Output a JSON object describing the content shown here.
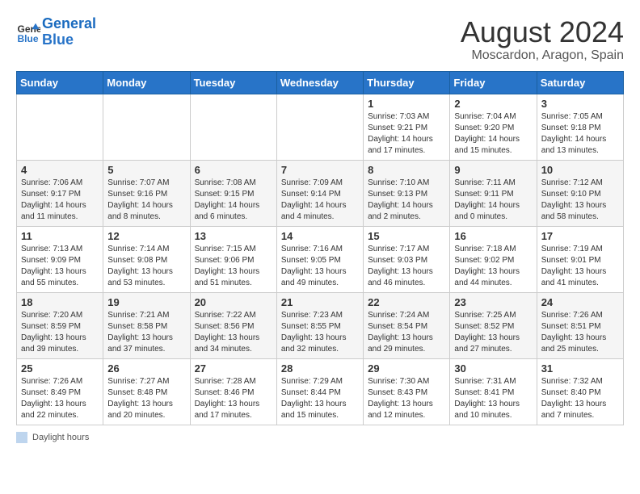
{
  "header": {
    "logo_line1": "General",
    "logo_line2": "Blue",
    "month_year": "August 2024",
    "location": "Moscardon, Aragon, Spain"
  },
  "days_of_week": [
    "Sunday",
    "Monday",
    "Tuesday",
    "Wednesday",
    "Thursday",
    "Friday",
    "Saturday"
  ],
  "weeks": [
    [
      {
        "day": "",
        "info": ""
      },
      {
        "day": "",
        "info": ""
      },
      {
        "day": "",
        "info": ""
      },
      {
        "day": "",
        "info": ""
      },
      {
        "day": "1",
        "info": "Sunrise: 7:03 AM\nSunset: 9:21 PM\nDaylight: 14 hours\nand 17 minutes."
      },
      {
        "day": "2",
        "info": "Sunrise: 7:04 AM\nSunset: 9:20 PM\nDaylight: 14 hours\nand 15 minutes."
      },
      {
        "day": "3",
        "info": "Sunrise: 7:05 AM\nSunset: 9:18 PM\nDaylight: 14 hours\nand 13 minutes."
      }
    ],
    [
      {
        "day": "4",
        "info": "Sunrise: 7:06 AM\nSunset: 9:17 PM\nDaylight: 14 hours\nand 11 minutes."
      },
      {
        "day": "5",
        "info": "Sunrise: 7:07 AM\nSunset: 9:16 PM\nDaylight: 14 hours\nand 8 minutes."
      },
      {
        "day": "6",
        "info": "Sunrise: 7:08 AM\nSunset: 9:15 PM\nDaylight: 14 hours\nand 6 minutes."
      },
      {
        "day": "7",
        "info": "Sunrise: 7:09 AM\nSunset: 9:14 PM\nDaylight: 14 hours\nand 4 minutes."
      },
      {
        "day": "8",
        "info": "Sunrise: 7:10 AM\nSunset: 9:13 PM\nDaylight: 14 hours\nand 2 minutes."
      },
      {
        "day": "9",
        "info": "Sunrise: 7:11 AM\nSunset: 9:11 PM\nDaylight: 14 hours\nand 0 minutes."
      },
      {
        "day": "10",
        "info": "Sunrise: 7:12 AM\nSunset: 9:10 PM\nDaylight: 13 hours\nand 58 minutes."
      }
    ],
    [
      {
        "day": "11",
        "info": "Sunrise: 7:13 AM\nSunset: 9:09 PM\nDaylight: 13 hours\nand 55 minutes."
      },
      {
        "day": "12",
        "info": "Sunrise: 7:14 AM\nSunset: 9:08 PM\nDaylight: 13 hours\nand 53 minutes."
      },
      {
        "day": "13",
        "info": "Sunrise: 7:15 AM\nSunset: 9:06 PM\nDaylight: 13 hours\nand 51 minutes."
      },
      {
        "day": "14",
        "info": "Sunrise: 7:16 AM\nSunset: 9:05 PM\nDaylight: 13 hours\nand 49 minutes."
      },
      {
        "day": "15",
        "info": "Sunrise: 7:17 AM\nSunset: 9:03 PM\nDaylight: 13 hours\nand 46 minutes."
      },
      {
        "day": "16",
        "info": "Sunrise: 7:18 AM\nSunset: 9:02 PM\nDaylight: 13 hours\nand 44 minutes."
      },
      {
        "day": "17",
        "info": "Sunrise: 7:19 AM\nSunset: 9:01 PM\nDaylight: 13 hours\nand 41 minutes."
      }
    ],
    [
      {
        "day": "18",
        "info": "Sunrise: 7:20 AM\nSunset: 8:59 PM\nDaylight: 13 hours\nand 39 minutes."
      },
      {
        "day": "19",
        "info": "Sunrise: 7:21 AM\nSunset: 8:58 PM\nDaylight: 13 hours\nand 37 minutes."
      },
      {
        "day": "20",
        "info": "Sunrise: 7:22 AM\nSunset: 8:56 PM\nDaylight: 13 hours\nand 34 minutes."
      },
      {
        "day": "21",
        "info": "Sunrise: 7:23 AM\nSunset: 8:55 PM\nDaylight: 13 hours\nand 32 minutes."
      },
      {
        "day": "22",
        "info": "Sunrise: 7:24 AM\nSunset: 8:54 PM\nDaylight: 13 hours\nand 29 minutes."
      },
      {
        "day": "23",
        "info": "Sunrise: 7:25 AM\nSunset: 8:52 PM\nDaylight: 13 hours\nand 27 minutes."
      },
      {
        "day": "24",
        "info": "Sunrise: 7:26 AM\nSunset: 8:51 PM\nDaylight: 13 hours\nand 25 minutes."
      }
    ],
    [
      {
        "day": "25",
        "info": "Sunrise: 7:26 AM\nSunset: 8:49 PM\nDaylight: 13 hours\nand 22 minutes."
      },
      {
        "day": "26",
        "info": "Sunrise: 7:27 AM\nSunset: 8:48 PM\nDaylight: 13 hours\nand 20 minutes."
      },
      {
        "day": "27",
        "info": "Sunrise: 7:28 AM\nSunset: 8:46 PM\nDaylight: 13 hours\nand 17 minutes."
      },
      {
        "day": "28",
        "info": "Sunrise: 7:29 AM\nSunset: 8:44 PM\nDaylight: 13 hours\nand 15 minutes."
      },
      {
        "day": "29",
        "info": "Sunrise: 7:30 AM\nSunset: 8:43 PM\nDaylight: 13 hours\nand 12 minutes."
      },
      {
        "day": "30",
        "info": "Sunrise: 7:31 AM\nSunset: 8:41 PM\nDaylight: 13 hours\nand 10 minutes."
      },
      {
        "day": "31",
        "info": "Sunrise: 7:32 AM\nSunset: 8:40 PM\nDaylight: 13 hours\nand 7 minutes."
      }
    ]
  ],
  "footer": {
    "daylight_label": "Daylight hours"
  }
}
